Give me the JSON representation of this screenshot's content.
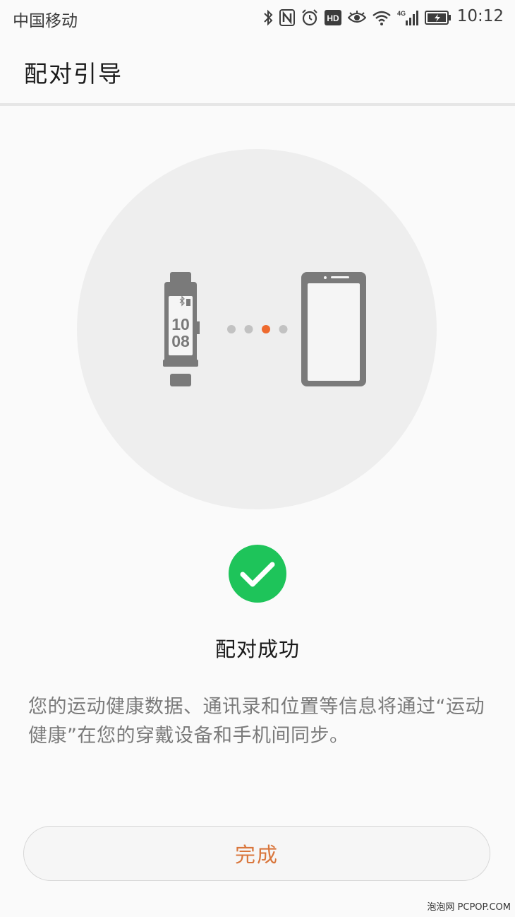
{
  "status_bar": {
    "carrier": "中国移动",
    "time": "10:12",
    "icons": [
      "bluetooth-icon",
      "nfc-icon",
      "alarm-icon",
      "hd-icon",
      "eye-icon",
      "wifi-icon",
      "4g-signal-icon",
      "battery-icon"
    ],
    "hd_label": "HD",
    "network_label": "4G"
  },
  "app_bar": {
    "title": "配对引导"
  },
  "illustration": {
    "band_time_hours": "10",
    "band_time_minutes": "08",
    "progress_dots": 4,
    "active_dot": 3,
    "active_dot_color": "#ee6a2e",
    "inactive_dot_color": "#c2c2c2",
    "device_color": "#7a7a7a"
  },
  "result": {
    "title": "配对成功",
    "description": "您的运动健康数据、通讯录和位置等信息将通过“运动健康”在您的穿戴设备和手机间同步。",
    "status_color": "#1ec45a"
  },
  "actions": {
    "done_label": "完成",
    "done_color": "#d9763c"
  },
  "watermark": "泡泡网 PCPOP.COM"
}
